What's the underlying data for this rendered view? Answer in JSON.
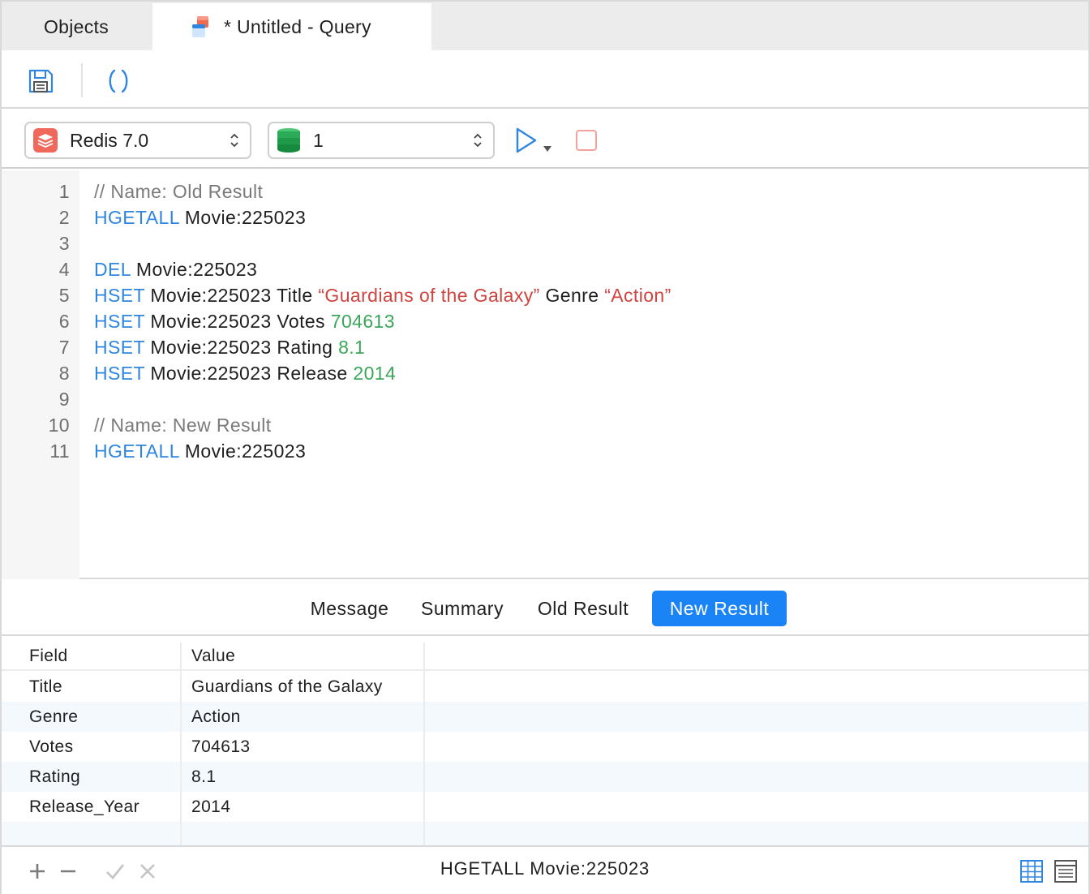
{
  "tabs": {
    "objects": "Objects",
    "query": "* Untitled - Query"
  },
  "connection": {
    "selected": "Redis 7.0"
  },
  "database": {
    "selected": "1"
  },
  "editor": {
    "lines": [
      {
        "n": "1",
        "tokens": [
          {
            "t": "// Name: Old Result",
            "c": "cmt"
          }
        ]
      },
      {
        "n": "2",
        "tokens": [
          {
            "t": "HGETALL",
            "c": "kw"
          },
          {
            "t": " Movie:225023",
            "c": ""
          }
        ]
      },
      {
        "n": "3",
        "tokens": []
      },
      {
        "n": "4",
        "tokens": [
          {
            "t": "DEL",
            "c": "kw"
          },
          {
            "t": " Movie:225023",
            "c": ""
          }
        ]
      },
      {
        "n": "5",
        "tokens": [
          {
            "t": "HSET",
            "c": "kw"
          },
          {
            "t": " Movie:225023 Title ",
            "c": ""
          },
          {
            "t": "“Guardians of the Galaxy”",
            "c": "str"
          },
          {
            "t": " Genre ",
            "c": ""
          },
          {
            "t": "“Action”",
            "c": "str"
          }
        ]
      },
      {
        "n": "6",
        "tokens": [
          {
            "t": "HSET",
            "c": "kw"
          },
          {
            "t": " Movie:225023 Votes ",
            "c": ""
          },
          {
            "t": "704613",
            "c": "num"
          }
        ]
      },
      {
        "n": "7",
        "tokens": [
          {
            "t": "HSET",
            "c": "kw"
          },
          {
            "t": " Movie:225023 Rating ",
            "c": ""
          },
          {
            "t": "8.1",
            "c": "num"
          }
        ]
      },
      {
        "n": "8",
        "tokens": [
          {
            "t": "HSET",
            "c": "kw"
          },
          {
            "t": " Movie:225023 Release ",
            "c": ""
          },
          {
            "t": "2014",
            "c": "num"
          }
        ]
      },
      {
        "n": "9",
        "tokens": []
      },
      {
        "n": "10",
        "tokens": [
          {
            "t": "// Name: New Result",
            "c": "cmt"
          }
        ]
      },
      {
        "n": "11",
        "tokens": [
          {
            "t": "HGETALL",
            "c": "kw"
          },
          {
            "t": " Movie:225023",
            "c": ""
          }
        ]
      }
    ]
  },
  "result_tabs": {
    "message": "Message",
    "summary": "Summary",
    "old_result": "Old Result",
    "new_result": "New Result",
    "active": "New Result"
  },
  "grid": {
    "columns": [
      "Field",
      "Value"
    ],
    "rows": [
      [
        "Title",
        "Guardians of the Galaxy"
      ],
      [
        "Genre",
        "Action"
      ],
      [
        "Votes",
        "704613"
      ],
      [
        "Rating",
        "8.1"
      ],
      [
        "Release_Year",
        "2014"
      ]
    ]
  },
  "status": {
    "query_text": "HGETALL Movie:225023"
  },
  "colors": {
    "accent": "#1a84f7",
    "keyword": "#2f86e0",
    "string": "#d0433f",
    "number": "#3ba65a",
    "comment": "#7a7a7a"
  },
  "icons": {
    "save": "save-icon",
    "refresh": "refresh-icon",
    "redis": "redis-icon",
    "database": "database-icon",
    "run": "play-icon",
    "stop": "stop-icon",
    "add": "plus-icon",
    "remove": "minus-icon",
    "apply": "check-icon",
    "discard": "x-icon",
    "grid_view": "grid-view-icon",
    "form_view": "form-view-icon"
  }
}
